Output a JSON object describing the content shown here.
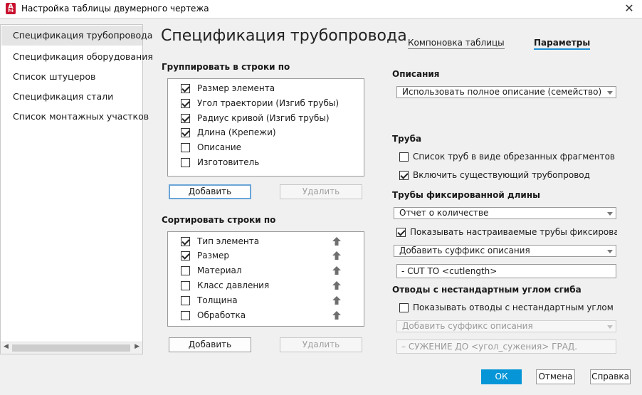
{
  "window": {
    "title": "Настройка таблицы двумерного чертежа",
    "app_icon_letter": "A",
    "app_icon_sub": "Plt"
  },
  "sidebar": {
    "items": [
      {
        "label": "Спецификация трубопровода",
        "selected": true
      },
      {
        "label": "Спецификация оборудования"
      },
      {
        "label": "Список штуцеров"
      },
      {
        "label": "Спецификация стали"
      },
      {
        "label": "Список монтажных участков"
      }
    ]
  },
  "page": {
    "title": "Спецификация трубопровода",
    "tabs": [
      {
        "label": "Компоновка таблицы"
      },
      {
        "label": "Параметры",
        "active": true
      }
    ]
  },
  "group_by": {
    "label": "Группировать в строки по",
    "items": [
      {
        "label": "Размер элемента",
        "checked": true
      },
      {
        "label": "Угол траектории (Изгиб трубы)",
        "checked": true
      },
      {
        "label": "Радиус кривой (Изгиб трубы)",
        "checked": true
      },
      {
        "label": "Длина (Крепежи)",
        "checked": true
      },
      {
        "label": "Описание",
        "checked": false
      },
      {
        "label": "Изготовитель",
        "checked": false
      }
    ],
    "add_label": "Добавить",
    "remove_label": "Удалить"
  },
  "sort_by": {
    "label": "Сортировать строки по",
    "items": [
      {
        "label": "Тип элемента",
        "checked": true
      },
      {
        "label": "Размер",
        "checked": true
      },
      {
        "label": "Материал",
        "checked": false
      },
      {
        "label": "Класс давления",
        "checked": false
      },
      {
        "label": "Толщина",
        "checked": false
      },
      {
        "label": "Обработка",
        "checked": false
      }
    ],
    "add_label": "Добавить",
    "remove_label": "Удалить"
  },
  "descriptions": {
    "label": "Описания",
    "value": "Использовать полное описание (семейство)"
  },
  "pipe": {
    "label": "Труба",
    "cut_pieces_label": "Список труб в виде обрезанных фрагментов",
    "cut_pieces_checked": false,
    "include_existing_label": "Включить существующий трубопровод",
    "include_existing_checked": true
  },
  "fixed_length": {
    "label": "Трубы фиксированной длины",
    "report_value": "Отчет о количестве",
    "show_custom_label": "Показывать настраиваемые трубы фиксированной д",
    "show_custom_checked": true,
    "suffix_value": "Добавить суффикс описания",
    "suffix_text": "- CUT TO <cutlength>"
  },
  "nonstd_bends": {
    "label": "Отводы с нестандартным углом сгиба",
    "show_label": "Показывать отводы с нестандартным углом сгиба ка",
    "show_checked": false,
    "suffix_value": "Добавить суффикс описания",
    "suffix_text": "– СУЖЕНИЕ ДО <угол_сужения> ГРАД."
  },
  "footer": {
    "ok_label": "ОК",
    "cancel_label": "Отмена",
    "help_label": "Справка"
  },
  "colors": {
    "accent": "#0696d7",
    "tab_underline": "#1e8fd6",
    "brand": "#c8102e"
  }
}
